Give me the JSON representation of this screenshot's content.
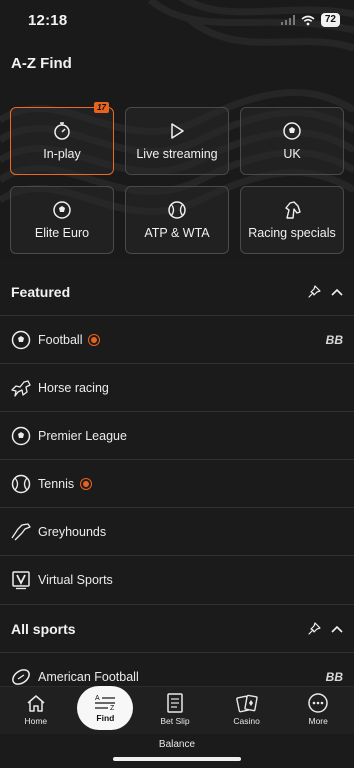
{
  "status_bar": {
    "time": "12:18",
    "battery": "72"
  },
  "page": {
    "title": "A-Z Find"
  },
  "tiles": [
    {
      "label": "In-play",
      "icon": "stopwatch-icon",
      "badge": "17",
      "active": true
    },
    {
      "label": "Live streaming",
      "icon": "play-icon"
    },
    {
      "label": "UK",
      "icon": "soccer-ball-icon"
    },
    {
      "label": "Elite Euro",
      "icon": "soccer-ball-icon"
    },
    {
      "label": "ATP & WTA",
      "icon": "tennis-ball-icon"
    },
    {
      "label": "Racing specials",
      "icon": "horse-head-icon"
    }
  ],
  "featured": {
    "title": "Featured",
    "items": [
      {
        "label": "Football",
        "icon": "soccer-ball-icon",
        "live": true,
        "bb": "BB"
      },
      {
        "label": "Horse racing",
        "icon": "horse-racing-icon"
      },
      {
        "label": "Premier League",
        "icon": "soccer-ball-icon"
      },
      {
        "label": "Tennis",
        "icon": "tennis-ball-icon",
        "live": true
      },
      {
        "label": "Greyhounds",
        "icon": "greyhound-icon"
      },
      {
        "label": "Virtual Sports",
        "icon": "virtual-v-icon"
      }
    ]
  },
  "all_sports": {
    "title": "All sports",
    "items": [
      {
        "label": "American Football",
        "icon": "american-football-icon",
        "bb": "BB"
      }
    ]
  },
  "bottom_nav": [
    {
      "label": "Home",
      "icon": "home-icon"
    },
    {
      "label": "Find",
      "icon": "a-z-icon",
      "active": true
    },
    {
      "label": "Bet Slip",
      "icon": "receipt-icon"
    },
    {
      "label": "Casino",
      "icon": "playing-cards-icon"
    },
    {
      "label": "More",
      "icon": "more-dots-icon"
    }
  ],
  "balance": {
    "label": "Balance"
  },
  "colors": {
    "accent": "#e8631e",
    "background": "#1b1b1b",
    "divider": "#333333"
  }
}
